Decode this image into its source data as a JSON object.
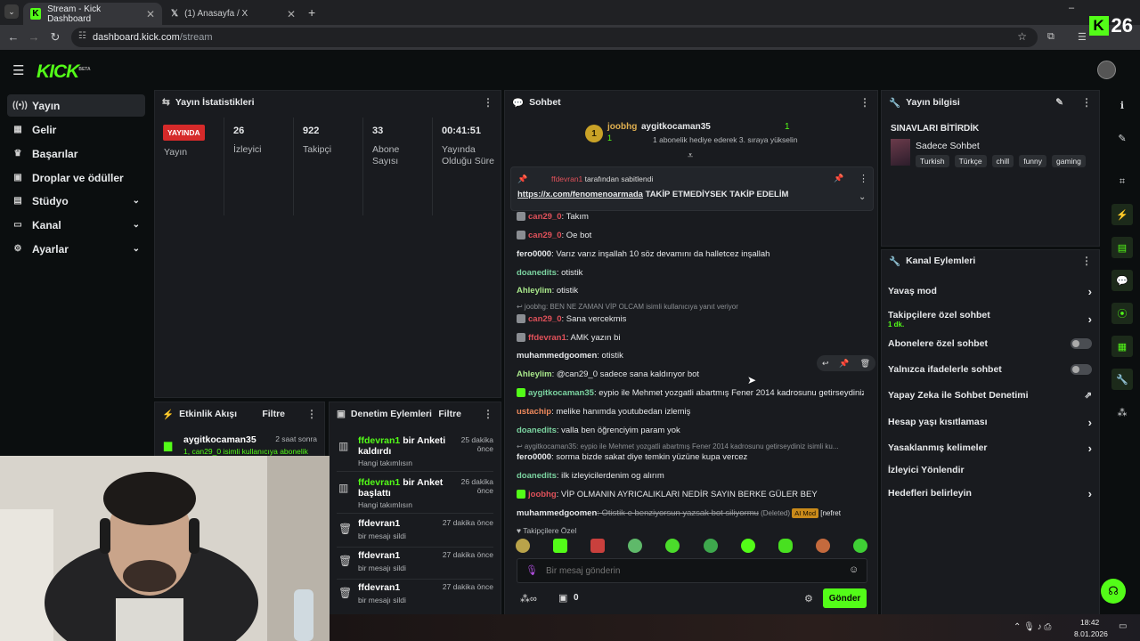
{
  "browser": {
    "tabs": [
      {
        "title": "Stream - Kick Dashboard",
        "active": true
      },
      {
        "title": "(1) Anasayfa / X",
        "active": false
      }
    ],
    "url_host": "dashboard.kick.com",
    "url_path": "/stream",
    "kick_badge_number": "26"
  },
  "brand": {
    "logo": "KICK",
    "beta": "BETA",
    "accent": "#53fc18"
  },
  "sidebar": {
    "items": [
      {
        "label": "Yayın",
        "icon": "broadcast-icon"
      },
      {
        "label": "Gelir",
        "icon": "revenue-icon"
      },
      {
        "label": "Başarılar",
        "icon": "trophy-icon"
      },
      {
        "label": "Droplar ve ödüller",
        "icon": "gift-icon"
      },
      {
        "label": "Stüdyo",
        "icon": "studio-icon"
      },
      {
        "label": "Kanal",
        "icon": "channel-icon"
      },
      {
        "label": "Ayarlar",
        "icon": "gear-icon"
      }
    ]
  },
  "stats": {
    "title": "Yayın İstatistikleri",
    "live_label": "YAYINDA",
    "status_label": "Yayın",
    "viewers": {
      "value": "26",
      "label": "İzleyici"
    },
    "followers": {
      "value": "922",
      "label": "Takipçi"
    },
    "subs": {
      "value": "33",
      "label": "Abone Sayısı"
    },
    "uptime": {
      "value": "00:41:51",
      "label": "Yayında Olduğu Süre"
    }
  },
  "activity": {
    "title": "Etkinlik Akışı",
    "filter": "Filtre",
    "items": [
      {
        "user": "aygitkocaman35",
        "time": "2 saat sonra",
        "sub": "1, can29_0 isimli kullanıcıya abonelik"
      }
    ]
  },
  "moderation": {
    "title": "Denetim Eylemleri",
    "filter": "Filtre",
    "items": [
      {
        "user": "ffdevran1",
        "action": "bir Anketi kaldırdı",
        "sub": "Hangi takımlısın",
        "time": "25 dakika önce"
      },
      {
        "user": "ffdevran1",
        "action": "bir Anket başlattı",
        "sub": "Hangi takımlısın",
        "time": "26 dakika önce"
      },
      {
        "user": "ffdevran1",
        "action": "",
        "sub": "bir mesajı sildi",
        "time": "27 dakika önce"
      },
      {
        "user": "ffdevran1",
        "action": "",
        "sub": "bir mesajı sildi",
        "time": "27 dakika önce"
      },
      {
        "user": "ffdevran1",
        "action": "",
        "sub": "bir mesajı sildi",
        "time": "27 dakika önce"
      }
    ]
  },
  "chat": {
    "title": "Sohbet",
    "gift_banner": {
      "rank": "1",
      "user": "joobhg",
      "count": "1",
      "gifter": "aygitkocaman35",
      "gift_count": "1",
      "text": "1 abonelik hediye ederek 3. sıraya yükselin"
    },
    "pinned": {
      "by": "ffdevran1",
      "by_suffix": "tarafından sabitlendi",
      "link": "https://x.com/fenomenoarmada",
      "text": "TAKİP ETMEDİYSEK TAKİP EDELİM"
    },
    "messages": [
      {
        "user": "can29_0",
        "text": ": Takım",
        "color": "#e0515a",
        "badges": true
      },
      {
        "user": "can29_0",
        "text": ": Oe bot",
        "color": "#e0515a",
        "badges": true
      },
      {
        "user": "fero0000",
        "text": ": Varız varız inşallah 10 söz devamını da halletcez inşallah",
        "color": "#e6e8ea"
      },
      {
        "user": "doanedits",
        "text": ": otistik",
        "color": "#7bd3a0"
      },
      {
        "user": "Ahleylim",
        "text": ": otistik",
        "color": "#a9e88b"
      },
      {
        "reply": "joobhg: BEN NE ZAMAN VİP OLCAM isimli kullanıcıya yanıt veriyor"
      },
      {
        "user": "can29_0",
        "text": ": Sana vercekmis",
        "color": "#e0515a",
        "badges": true
      },
      {
        "user": "ffdevran1",
        "text": ": AMK yazın bi",
        "color": "#e0515a",
        "badges": true
      },
      {
        "user": "muhammedgoomen",
        "text": ": otistik",
        "color": "#e6e8ea"
      },
      {
        "user": "Ahleylim",
        "text": ": @can29_0 sadece sana kaldırıyor bot",
        "color": "#a9e88b"
      },
      {
        "user": "aygitkocaman35",
        "text": ": eypio ile Mehmet yozgatli abartmış Fener 2014 kadrosunu getirseydiniz",
        "color": "#7bd3a0",
        "badges": true
      },
      {
        "user": "ustachip",
        "text": ": melike hanımda youtubedan izlemiş",
        "color": "#f08a5d"
      },
      {
        "user": "doanedits",
        "text": ": valla ben öğrenciyim param yok",
        "color": "#7bd3a0"
      },
      {
        "reply": "aygitkocaman35: eypio ile Mehmet yozgatli abartmış Fener 2014 kadrosunu getirseydiniz isimli ku..."
      },
      {
        "user": "fero0000",
        "text": ": sorma bizde sakat diye temkin yüzüne kupa vercez",
        "color": "#e6e8ea"
      },
      {
        "user": "doanedits",
        "text": ": ilk izleyicilerdenim og alırım",
        "color": "#7bd3a0"
      },
      {
        "user": "joobhg",
        "text": ": VİP OLMANIN AYRICALIKLARI NEDİR SAYIN BERKE GÜLER BEY",
        "color": "#e0515a",
        "badges": true
      },
      {
        "user": "muhammedgoomen",
        "text": ": Otistik e benziyorsun yazsak bot siliyormu",
        "color": "#e6e8ea",
        "deleted": "(Deleted)",
        "tag": "AI Mod",
        "tail": "[nefret"
      }
    ],
    "followers_only": "Takipçilere Özel",
    "input_placeholder": "Bir mesaj gönderin",
    "points": "0",
    "send": "Gönder"
  },
  "stream_info": {
    "title": "Yayın bilgisi",
    "stream_title": "SINAVLARI BİTİRDİK",
    "category": "Sadece Sohbet",
    "tags": [
      "Turkish",
      "Türkçe",
      "chill",
      "funny",
      "gaming"
    ]
  },
  "channel_actions": {
    "title": "Kanal Eylemleri",
    "rows": [
      {
        "label": "Yavaş mod",
        "control": "chevron"
      },
      {
        "label": "Takipçilere özel sohbet",
        "sub": "1 dk.",
        "control": "chevron"
      },
      {
        "label": "Abonelere özel sohbet",
        "control": "toggle"
      },
      {
        "label": "Yalnızca ifadelerle sohbet",
        "control": "toggle"
      },
      {
        "label": "Yapay Zeka ile Sohbet Denetimi",
        "control": "external"
      },
      {
        "label": "Hesap yaşı kısıtlaması",
        "control": "chevron"
      },
      {
        "label": "Yasaklanmış kelimeler",
        "control": "chevron"
      },
      {
        "label": "İzleyici Yönlendir",
        "control": "none"
      },
      {
        "label": "Hedefleri belirleyin",
        "control": "chevron"
      }
    ]
  },
  "taskbar": {
    "time": "18:42",
    "date": "8.01.2026"
  }
}
